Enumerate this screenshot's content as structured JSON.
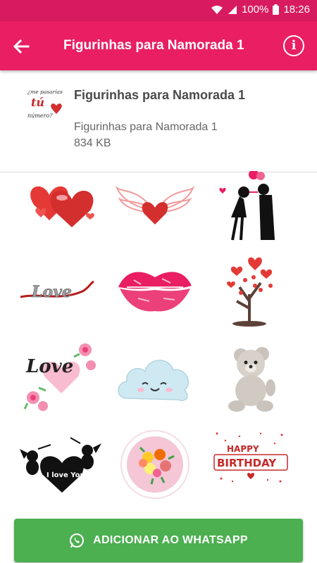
{
  "status_bar": {
    "battery": "100%",
    "time": "18:26",
    "icons": [
      "wifi-icon",
      "signal-icon",
      "battery-icon"
    ]
  },
  "app_bar": {
    "title": "Figurinhas para Namorada 1",
    "back_icon": "arrow-back-icon",
    "info_icon": "info-icon"
  },
  "pack": {
    "name": "Figurinhas para Namorada 1",
    "publisher": "Figurinhas para Namorada 1",
    "size": "834 KB",
    "tray_icon_text": [
      "¿me pasarías",
      "tú",
      "número?"
    ]
  },
  "stickers": [
    {
      "name": "sticker-red-hearts"
    },
    {
      "name": "sticker-winged-heart"
    },
    {
      "name": "sticker-couple-kiss"
    },
    {
      "name": "sticker-love-text",
      "text": "Love"
    },
    {
      "name": "sticker-pink-lips"
    },
    {
      "name": "sticker-heart-tree"
    },
    {
      "name": "sticker-love-roses",
      "text": "Love"
    },
    {
      "name": "sticker-smiling-cloud"
    },
    {
      "name": "sticker-teddy-bear"
    },
    {
      "name": "sticker-cupids-i-love-you",
      "text": "I love You"
    },
    {
      "name": "sticker-flower-bouquet"
    },
    {
      "name": "sticker-happy-birthday",
      "text": [
        "HAPPY",
        "BIRTHDAY"
      ]
    }
  ],
  "add_button": {
    "label": "ADICIONAR AO WHATSAPP",
    "icon": "whatsapp-icon"
  },
  "colors": {
    "status_bar": "#d81b60",
    "app_bar": "#e91e63",
    "add_button": "#4caf50"
  }
}
